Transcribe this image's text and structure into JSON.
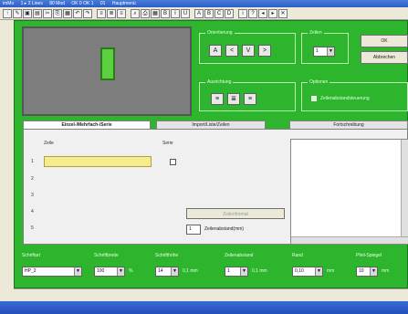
{
  "window": {
    "title_parts": [
      "imMo",
      "1 ▸ 2 Lines",
      "80 Mod",
      "OK 0 OK 1",
      "01",
      "Hauptmenü"
    ]
  },
  "toolbar": {
    "icons": [
      "arrow-up-icon",
      "pencil-icon",
      "open-icon",
      "save-icon",
      "cut-icon",
      "copy-icon",
      "paste-icon",
      "undo-icon",
      "redo-icon",
      "sep",
      "align-left-icon",
      "align-center-icon",
      "align-right-icon",
      "sep",
      "zoom-icon",
      "print-icon",
      "grid-icon",
      "bold-icon",
      "italic-icon",
      "underline-icon",
      "sep",
      "letter-a-icon",
      "letter-b-icon",
      "letter-c-icon",
      "letter-d-icon",
      "sep",
      "info-icon",
      "help-icon",
      "arrow-left-icon",
      "arrow-right-icon",
      "close-icon"
    ],
    "glyphs": [
      "↑",
      "✎",
      "▣",
      "▤",
      "✂",
      "⎘",
      "▦",
      "↶",
      "↷",
      "",
      "≡",
      "≣",
      "≡",
      "",
      "⌕",
      "⎙",
      "▦",
      "B",
      "I",
      "U",
      "",
      "A",
      "B",
      "C",
      "D",
      "",
      "i",
      "?",
      "◂",
      "▸",
      "✕"
    ]
  },
  "orientation": {
    "label": "Orientierung",
    "buttons": [
      "A",
      "<",
      "V",
      ">"
    ]
  },
  "zeilen": {
    "label": "Zeilen",
    "value": "1"
  },
  "actions": {
    "ok": "OK",
    "cancel": "Abbrechen"
  },
  "ausrichtung": {
    "label": "Ausrichtung",
    "buttons": [
      "≡",
      "≣",
      "≡"
    ]
  },
  "optionen": {
    "label": "Optionen",
    "checkbox_label": "Zeilenabstandsteuerung"
  },
  "tabs": [
    "Einzel-/Mehrfach-/Serie",
    "Import/Liste/Zeilen",
    "Fortschreibung"
  ],
  "panel": {
    "col_zeile": "Zeile",
    "col_serie": "Serie",
    "rows": [
      "1",
      "2",
      "3",
      "4",
      "5"
    ],
    "zeilenformat_button": "Zeilenformat",
    "zeilenabstand_value": "1",
    "zeilenabstand_label": "Zeilenabstand(mm)"
  },
  "bottom": {
    "labels": [
      "Schriftart",
      "Schriftbreite",
      "Schrifthöhe",
      "Zeilenabstand",
      "Rand",
      "Pfeil-Spiegel"
    ],
    "schriftart": "HP_2",
    "schriftbreite": "100",
    "schriftbreite_unit": "%",
    "schrifthoehe": "14",
    "schrifthoehe_unit": "0,1 mm",
    "zeilenabstand": "1",
    "zeilenabstand_unit": "0,1 mm",
    "rand": "0,10",
    "rand_unit": "mm",
    "spiegel": "10",
    "spiegel_unit": "mm"
  },
  "colors": {
    "frame_green": "#2db52d",
    "preview_gray": "#7d7d7d",
    "block_green": "#5cd040",
    "input_yellow": "#f6ec8e"
  }
}
